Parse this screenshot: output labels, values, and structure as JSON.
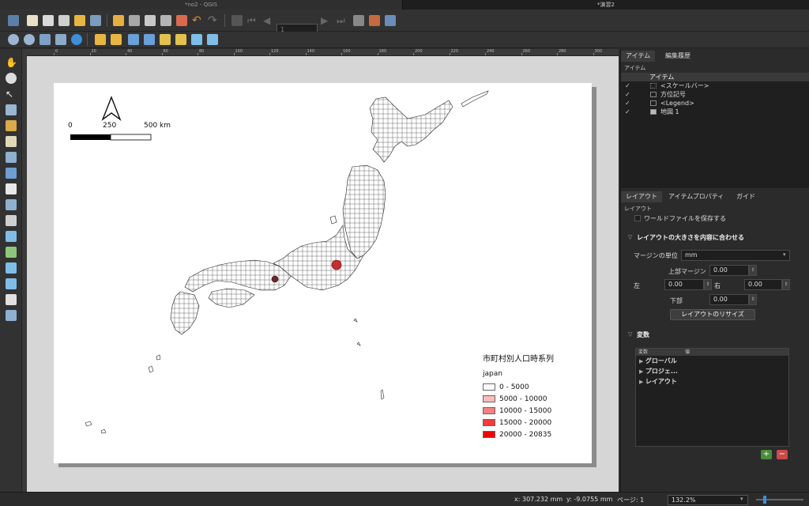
{
  "window": {
    "tab_left": "*no2 - QGIS",
    "tab_right": "*演習2"
  },
  "toolbar": {
    "page_number": "1"
  },
  "ruler": {
    "labels": [
      "0",
      "20",
      "40",
      "60",
      "80",
      "100",
      "120",
      "140",
      "160",
      "180",
      "200",
      "220",
      "240",
      "260",
      "280",
      "300"
    ]
  },
  "map": {
    "scalebar": {
      "labels": [
        "0",
        "250",
        "500 km"
      ]
    },
    "legend": {
      "title": "市町村別人口時系列",
      "layer": "japan",
      "classes": [
        {
          "label": "0 - 5000",
          "color": "#ffffff"
        },
        {
          "label": "5000 - 10000",
          "color": "#fcbcbc"
        },
        {
          "label": "10000 - 15000",
          "color": "#f78080"
        },
        {
          "label": "15000 - 20000",
          "color": "#f23c3c"
        },
        {
          "label": "20000 - 20835",
          "color": "#ee0000"
        }
      ]
    }
  },
  "panel": {
    "tabs_top": [
      "アイテム",
      "編集履歴"
    ],
    "items_header": "アイテム",
    "tree_header": "アイテム",
    "items": [
      {
        "label": "<スケールバー>",
        "checked": "✓"
      },
      {
        "label": "方位記号",
        "checked": "✓"
      },
      {
        "label": "<Legend>",
        "checked": "✓"
      },
      {
        "label": "地図 1",
        "checked": "✓"
      }
    ],
    "tabs_bottom": [
      "レイアウト",
      "アイテムプロパティ",
      "ガイド"
    ],
    "layout_header": "レイアウト",
    "world_file": "ワールドファイルを保存する",
    "resize_section": "レイアウトの大きさを内容に合わせる",
    "margin_unit_label": "マージンの単位",
    "margin_unit_value": "mm",
    "top_margin_label": "上部マージン",
    "top_margin": "0.00",
    "left_label": "左",
    "left_margin": "0.00",
    "right_label": "右",
    "right_margin": "0.00",
    "bottom_label": "下部",
    "bottom_margin": "0.00",
    "resize_button": "レイアウトのリサイズ",
    "variables_section": "変数",
    "var_col_var": "変数",
    "var_col_val": "値",
    "variables": [
      "グローバル",
      "プロジェ...",
      "レイアウト"
    ]
  },
  "status": {
    "x": "x: 307.232 mm",
    "y": "y: -9.0755 mm",
    "page": "ページ: 1",
    "zoom": "132.2%"
  }
}
